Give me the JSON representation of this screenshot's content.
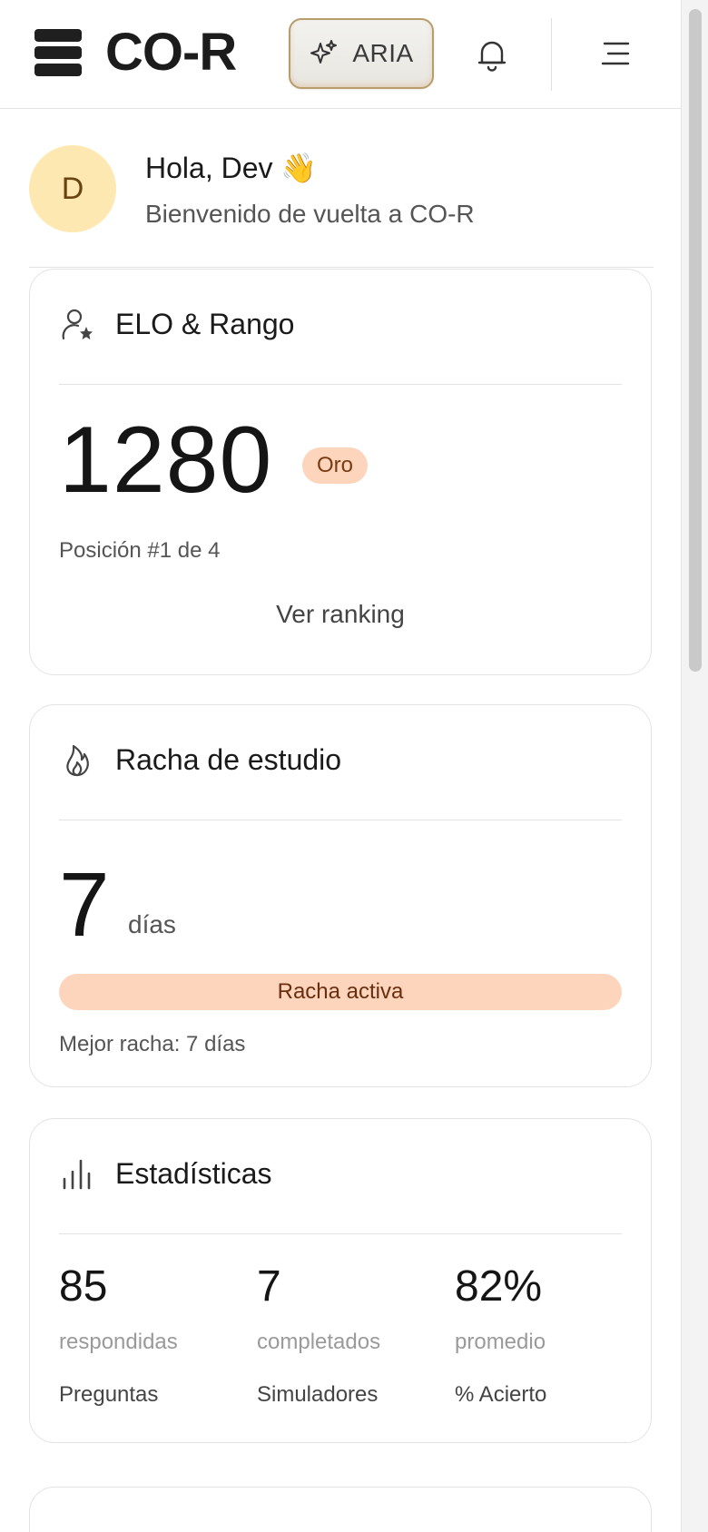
{
  "header": {
    "logo_text": "CO-R",
    "aria_label": "ARIA"
  },
  "greeting": {
    "avatar_initial": "D",
    "title": "Hola, Dev 👋",
    "subtitle": "Bienvenido de vuelta a CO-R"
  },
  "elo": {
    "title": "ELO & Rango",
    "value": "1280",
    "rank": "Oro",
    "position": "Posición #1 de 4",
    "link": "Ver ranking"
  },
  "streak": {
    "title": "Racha de estudio",
    "days": "7",
    "unit": "días",
    "status": "Racha activa",
    "best": "Mejor racha: 7 días"
  },
  "stats": {
    "title": "Estadísticas",
    "items": [
      {
        "value": "85",
        "unit": "respondidas",
        "label": "Preguntas"
      },
      {
        "value": "7",
        "unit": "completados",
        "label": "Simuladores"
      },
      {
        "value": "82%",
        "unit": "promedio",
        "label": "% Acierto"
      }
    ]
  },
  "colors": {
    "accent_badge": "#fdd5bd",
    "avatar_bg": "#fde8b2",
    "aria_border": "#b89d6a"
  },
  "icons": {
    "logo": "stack-logo-icon",
    "aria": "sparkle-icon",
    "notifications": "bell-icon",
    "menu": "menu-icon",
    "elo": "user-star-icon",
    "streak": "flame-icon",
    "stats": "bar-chart-icon"
  }
}
